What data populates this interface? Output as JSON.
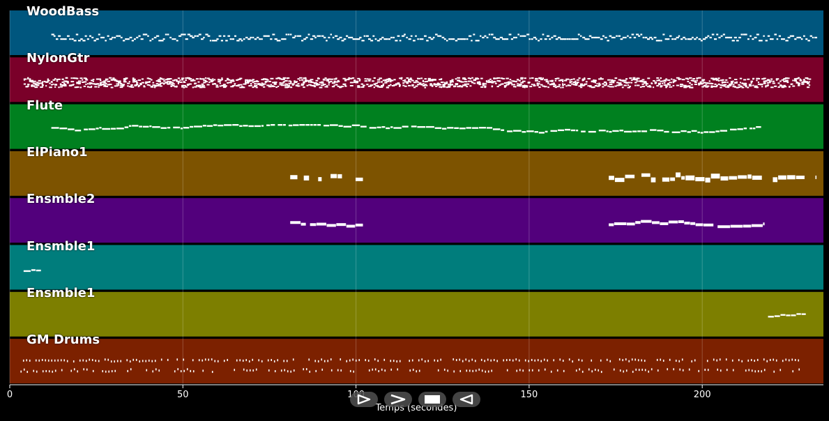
{
  "x_axis": {
    "label": "Temps (secondes)",
    "ticks": [
      "0",
      "50",
      "100",
      "150",
      "200"
    ],
    "tick_values": [
      0,
      50,
      100,
      150,
      200
    ],
    "range": [
      0,
      235
    ]
  },
  "tracks": [
    {
      "name": "WoodBass",
      "color": "#00567e",
      "note_style": "dense_dashes",
      "active_ranges": [
        [
          12,
          233
        ]
      ]
    },
    {
      "name": "NylonGtr",
      "color": "#7a0029",
      "note_style": "chords",
      "active_ranges": [
        [
          4,
          231
        ]
      ]
    },
    {
      "name": "Flute",
      "color": "#00801f",
      "note_style": "melody",
      "active_ranges": [
        [
          12,
          217
        ]
      ]
    },
    {
      "name": "ElPiano1",
      "color": "#7d5300",
      "note_style": "blocks",
      "active_ranges": [
        [
          81,
          102
        ],
        [
          173,
          233
        ]
      ]
    },
    {
      "name": "Ensmble2",
      "color": "#52007c",
      "note_style": "sustained",
      "active_ranges": [
        [
          81,
          102
        ],
        [
          173,
          218
        ]
      ]
    },
    {
      "name": "Ensmble1",
      "color": "#007d7c",
      "note_style": "melody",
      "active_ranges": [
        [
          4,
          9
        ]
      ]
    },
    {
      "name": "Ensmble1",
      "color": "#7d7f00",
      "note_style": "melody",
      "active_ranges": [
        [
          219,
          230
        ]
      ]
    },
    {
      "name": "GM Drums",
      "color": "#7c2100",
      "note_style": "drums",
      "active_ranges": [
        [
          2,
          228
        ]
      ]
    }
  ],
  "controls": [
    {
      "name": "rewind-icon",
      "glyph": "play-outline"
    },
    {
      "name": "play-icon",
      "glyph": "chevron-right"
    },
    {
      "name": "stop-icon",
      "glyph": "square"
    },
    {
      "name": "back-icon",
      "glyph": "play-left-outline"
    }
  ]
}
